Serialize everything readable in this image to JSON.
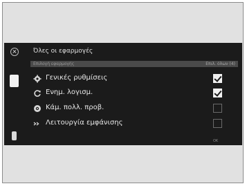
{
  "header": {
    "title": "Όλες οι εφαρμογές"
  },
  "subbar": {
    "left_text": "Επιλογή εφαρμογής",
    "right_text": "Επιλ. όλων (4)"
  },
  "items": [
    {
      "label": "Γενικές ρυθμίσεις",
      "icon": "gear-icon",
      "checked": true
    },
    {
      "label": "Ενημ. λογισμ.",
      "icon": "refresh-icon",
      "checked": true
    },
    {
      "label": "Κάμ. πολλ. προβ.",
      "icon": "camera-icon",
      "checked": false
    },
    {
      "label": "Λειτουργία εμφάνισης",
      "icon": "arrows-icon",
      "checked": false
    }
  ],
  "footer": {
    "note": "OK"
  }
}
